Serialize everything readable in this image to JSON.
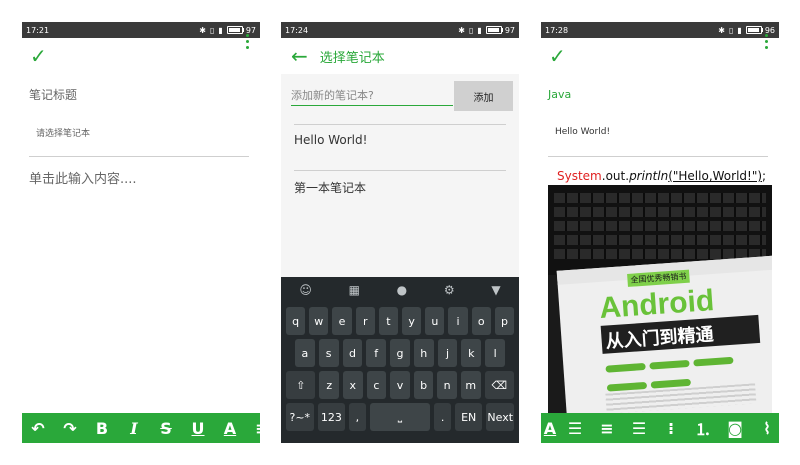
{
  "colors": {
    "accent": "#2aa83a",
    "statusbar": "#3a3a3a",
    "keyboard": "#24292c"
  },
  "screen1": {
    "status": {
      "time": "17:21",
      "battery": "97",
      "battery_level": 0.97
    },
    "title_placeholder": "笔记标题",
    "notebook_placeholder": "请选择笔记本",
    "content_placeholder": "单击此输入内容....",
    "format_icons": [
      "undo-icon",
      "redo-icon",
      "bold-icon",
      "italic-icon",
      "strikethrough-icon",
      "underline-icon",
      "text-color-icon",
      "align-icon"
    ],
    "format_labels": {
      "bold": "B",
      "italic": "I",
      "strike": "S",
      "underline": "U",
      "color": "A"
    }
  },
  "screen2": {
    "status": {
      "time": "17:24",
      "battery": "97",
      "battery_level": 0.97
    },
    "title": "选择笔记本",
    "add_input_placeholder": "添加新的笔记本?",
    "add_button": "添加",
    "notebooks": [
      "Hello World!",
      "第一本笔记本"
    ],
    "keyboard": {
      "row1": [
        "q",
        "w",
        "e",
        "r",
        "t",
        "y",
        "u",
        "i",
        "o",
        "p"
      ],
      "row2": [
        "a",
        "s",
        "d",
        "f",
        "g",
        "h",
        "j",
        "k",
        "l"
      ],
      "row3": [
        "z",
        "x",
        "c",
        "v",
        "b",
        "n",
        "m"
      ],
      "num_key": "?~*",
      "sym_key": "123",
      "comma": ",",
      "period": ".",
      "lang_key": "EN",
      "next_key": "Next"
    }
  },
  "screen3": {
    "status": {
      "time": "17:28",
      "battery": "96",
      "battery_level": 0.96
    },
    "title": "Java",
    "notebook": "Hello World!",
    "code": {
      "class": "System",
      "sep1": ".",
      "field": "out",
      "sep2": ".",
      "method": "println",
      "arg": "(\"Hello,World!\")",
      "end": ";"
    },
    "image_book": {
      "brand": "Android",
      "subtitle": "从入门到精通",
      "badge": "全国优秀畅销书"
    },
    "format_icons": [
      "text-color-icon",
      "align-left-icon",
      "align-center-icon",
      "align-right-icon",
      "bullet-list-icon",
      "numbered-list-icon",
      "camera-icon",
      "attachment-icon"
    ],
    "format_labels": {
      "color": "A"
    }
  }
}
